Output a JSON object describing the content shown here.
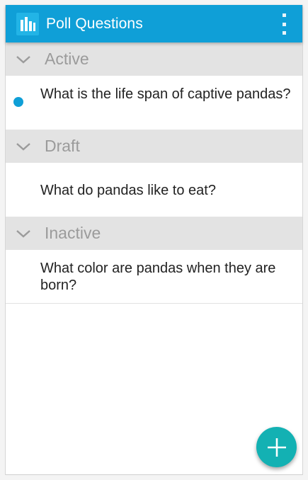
{
  "app_bar": {
    "title": "Poll Questions",
    "app_icon": "bar-chart-icon",
    "overflow_icon": "more-vert-icon",
    "color": "#0f9fd7"
  },
  "sections": [
    {
      "label": "Active",
      "chevron_icon": "chevron-down-icon",
      "items": [
        {
          "text": "What is the life span of captive pandas?",
          "status_dot": true
        }
      ]
    },
    {
      "label": "Draft",
      "chevron_icon": "chevron-down-icon",
      "items": [
        {
          "text": "What do pandas like to eat?",
          "status_dot": false
        }
      ]
    },
    {
      "label": "Inactive",
      "chevron_icon": "chevron-down-icon",
      "items": [
        {
          "text": "What color are pandas when they are born?",
          "status_dot": false
        }
      ]
    }
  ],
  "fab": {
    "icon": "plus-icon",
    "color": "#13b1b3"
  },
  "colors": {
    "section_header_bg": "#e3e3e3",
    "section_label": "#9b9b9b",
    "status_active": "#0f9fd7"
  }
}
